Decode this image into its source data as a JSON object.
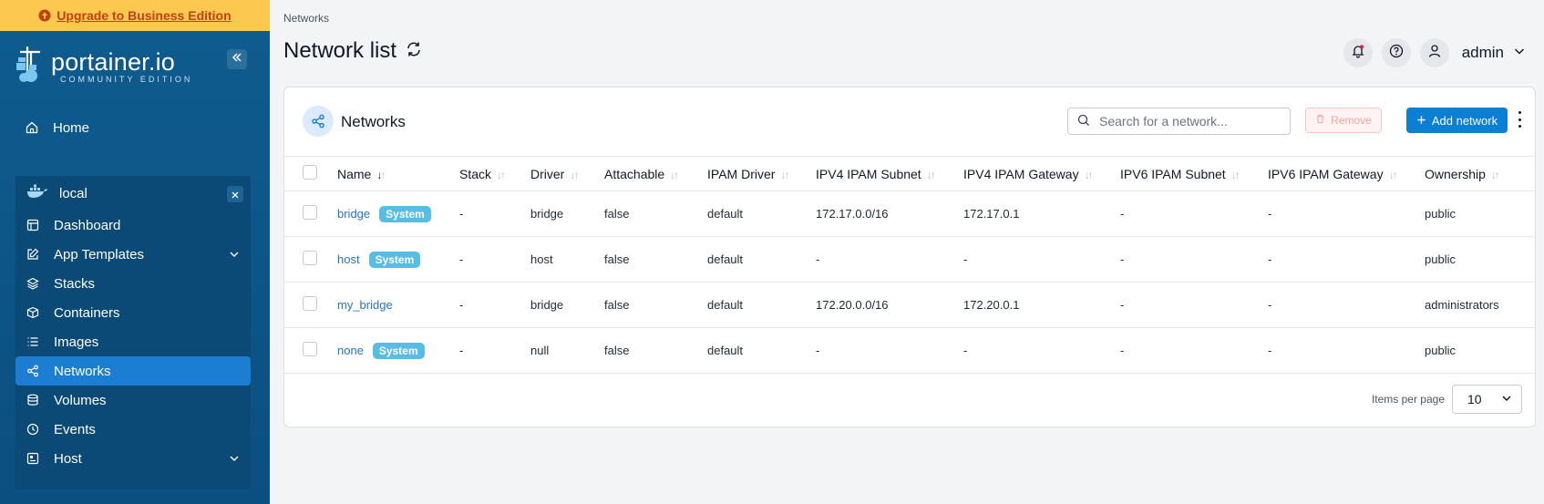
{
  "sidebar": {
    "upgrade_label": "Upgrade to Business Edition",
    "brand_main": "portainer.io",
    "brand_sub": "COMMUNITY EDITION",
    "home_label": "Home",
    "environment": {
      "name": "local",
      "items": [
        {
          "label": "Dashboard",
          "icon": "dashboard-icon"
        },
        {
          "label": "App Templates",
          "icon": "edit-icon",
          "expandable": true
        },
        {
          "label": "Stacks",
          "icon": "layers-icon"
        },
        {
          "label": "Containers",
          "icon": "box-icon"
        },
        {
          "label": "Images",
          "icon": "list-icon"
        },
        {
          "label": "Networks",
          "icon": "share-icon",
          "active": true
        },
        {
          "label": "Volumes",
          "icon": "database-icon"
        },
        {
          "label": "Events",
          "icon": "clock-icon"
        },
        {
          "label": "Host",
          "icon": "server-icon",
          "expandable": true
        }
      ]
    }
  },
  "header": {
    "breadcrumb": "Networks",
    "title": "Network list",
    "user": "admin"
  },
  "card": {
    "title": "Networks",
    "search_placeholder": "Search for a network...",
    "remove_label": "Remove",
    "add_label": "Add network"
  },
  "table": {
    "columns": [
      "Name",
      "Stack",
      "Driver",
      "Attachable",
      "IPAM Driver",
      "IPV4 IPAM Subnet",
      "IPV4 IPAM Gateway",
      "IPV6 IPAM Subnet",
      "IPV6 IPAM Gateway",
      "Ownership"
    ],
    "rows": [
      {
        "name": "bridge",
        "system": true,
        "stack": "-",
        "driver": "bridge",
        "attachable": "false",
        "ipam_driver": "default",
        "ipv4_subnet": "172.17.0.0/16",
        "ipv4_gateway": "172.17.0.1",
        "ipv6_subnet": "-",
        "ipv6_gateway": "-",
        "ownership": "public"
      },
      {
        "name": "host",
        "system": true,
        "stack": "-",
        "driver": "host",
        "attachable": "false",
        "ipam_driver": "default",
        "ipv4_subnet": "-",
        "ipv4_gateway": "-",
        "ipv6_subnet": "-",
        "ipv6_gateway": "-",
        "ownership": "public"
      },
      {
        "name": "my_bridge",
        "system": false,
        "stack": "-",
        "driver": "bridge",
        "attachable": "false",
        "ipam_driver": "default",
        "ipv4_subnet": "172.20.0.0/16",
        "ipv4_gateway": "172.20.0.1",
        "ipv6_subnet": "-",
        "ipv6_gateway": "-",
        "ownership": "administrators"
      },
      {
        "name": "none",
        "system": true,
        "stack": "-",
        "driver": "null",
        "attachable": "false",
        "ipam_driver": "default",
        "ipv4_subnet": "-",
        "ipv4_gateway": "-",
        "ipv6_subnet": "-",
        "ipv6_gateway": "-",
        "ownership": "public"
      }
    ],
    "system_badge": "System"
  },
  "footer": {
    "items_per_page_label": "Items per page",
    "items_per_page_value": "10"
  },
  "colors": {
    "sidebar_bg": "#0f5c8f",
    "active_item": "#1b7ed3",
    "accent": "#0b7fd4",
    "badge": "#58bde5",
    "upgrade_bg": "#fcc850"
  }
}
